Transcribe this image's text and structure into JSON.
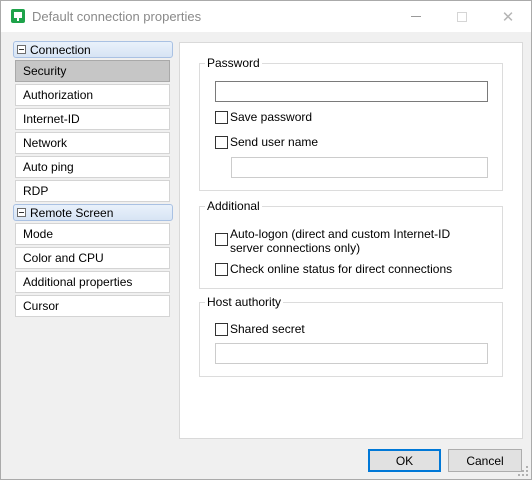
{
  "window": {
    "title": "Default connection properties",
    "controls": {
      "minimize": "minimize",
      "maximize": "maximize",
      "close": "✕"
    }
  },
  "sidebar": {
    "groups": [
      {
        "label": "Connection",
        "items": [
          {
            "label": "Security",
            "selected": true
          },
          {
            "label": "Authorization"
          },
          {
            "label": "Internet-ID"
          },
          {
            "label": "Network"
          },
          {
            "label": "Auto ping"
          },
          {
            "label": "RDP"
          }
        ]
      },
      {
        "label": "Remote Screen",
        "items": [
          {
            "label": "Mode"
          },
          {
            "label": "Color and CPU"
          },
          {
            "label": "Additional properties"
          },
          {
            "label": "Cursor"
          }
        ]
      }
    ]
  },
  "security": {
    "password": {
      "title": "Password",
      "password_value": "",
      "save_password": {
        "label": "Save password",
        "checked": false
      },
      "send_user_name": {
        "label": "Send user name",
        "checked": false
      },
      "user_name_value": ""
    },
    "additional": {
      "title": "Additional",
      "auto_logon": {
        "label": "Auto-logon (direct and custom Internet-ID server connections only)",
        "checked": false
      },
      "check_online": {
        "label": "Check online status for direct connections",
        "checked": false
      }
    },
    "host_authority": {
      "title": "Host authority",
      "shared_secret": {
        "label": "Shared secret",
        "checked": false
      },
      "shared_secret_value": ""
    }
  },
  "footer": {
    "ok_label": "OK",
    "cancel_label": "Cancel"
  },
  "colors": {
    "selected_item": "#c6c6c6",
    "group_header": "#d7e4f4",
    "default_button_border": "#0078d7",
    "app_icon": "#1ea34a"
  }
}
